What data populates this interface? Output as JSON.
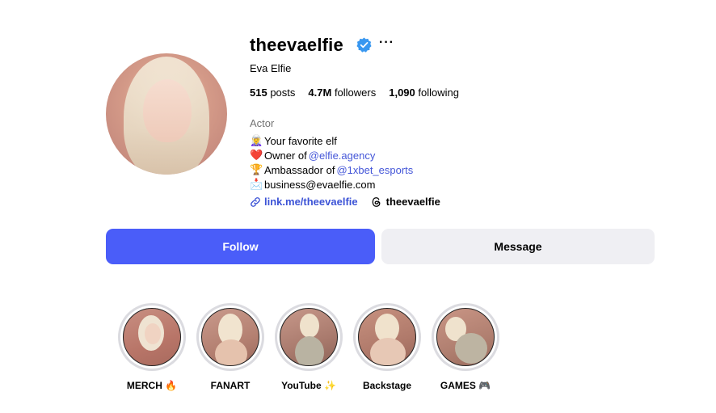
{
  "profile": {
    "username": "theevaelfie",
    "full_name": "Eva Elfie",
    "more_label": "···",
    "stats": [
      {
        "value": "515",
        "label": "posts"
      },
      {
        "value": "4.7M",
        "label": "followers"
      },
      {
        "value": "1,090",
        "label": "following"
      }
    ],
    "category": "Actor",
    "bio": [
      {
        "emoji": "🧝‍♀️",
        "text": "Your favorite elf",
        "mention": ""
      },
      {
        "emoji": "❤️",
        "text": "Owner of ",
        "mention": "@elfie.agency"
      },
      {
        "emoji": "🏆",
        "text": "Ambassador of ",
        "mention": "@1xbet_esports"
      },
      {
        "emoji": "📩",
        "text": "business@evaelfie.com",
        "mention": ""
      }
    ],
    "link_text": "link.me/theevaelfie",
    "threads_text": "theevaelfie"
  },
  "buttons": {
    "follow": "Follow",
    "message": "Message"
  },
  "highlights": [
    {
      "label": "MERCH 🔥"
    },
    {
      "label": "FANART"
    },
    {
      "label": "YouTube ✨"
    },
    {
      "label": "Backstage"
    },
    {
      "label": "GAMES 🎮"
    }
  ],
  "colors": {
    "follow_bg": "#4a5df9",
    "message_bg": "#efeff3",
    "verified": "#3897f0",
    "link": "#3c53d6",
    "mention": "#4456d8"
  }
}
